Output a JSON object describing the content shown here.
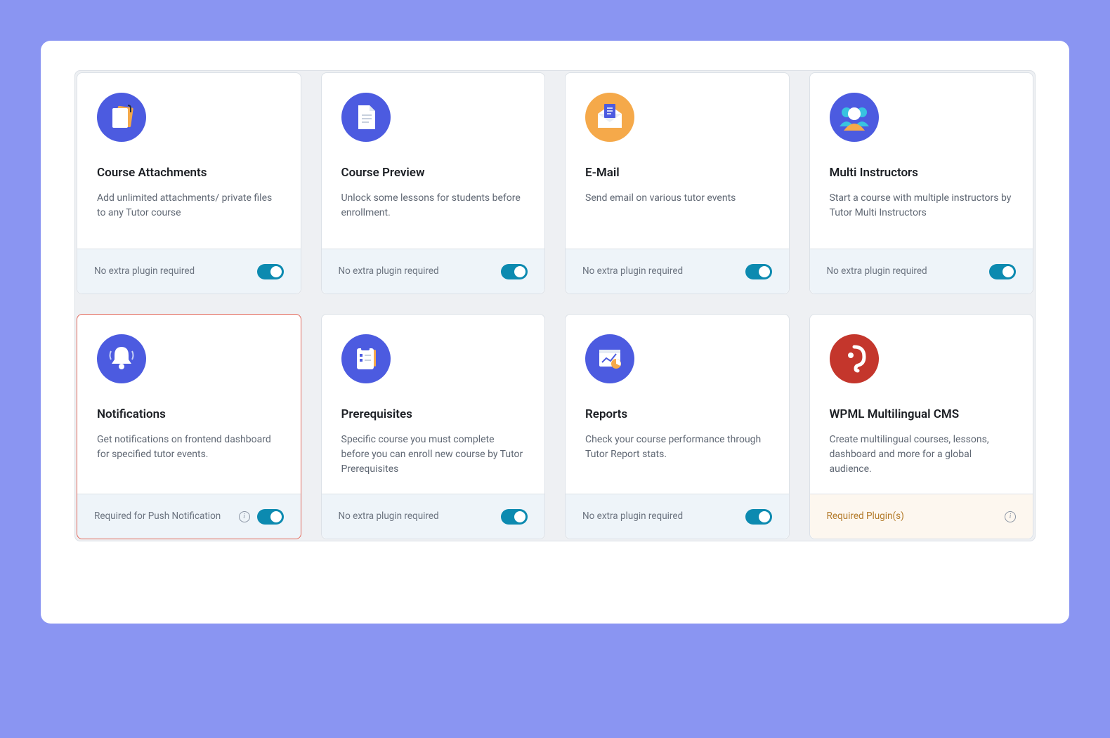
{
  "colors": {
    "blue": "#4c5be0",
    "orange": "#f5a94a",
    "red": "#c4362c"
  },
  "addons": [
    {
      "id": "course-attachments",
      "icon": "attachment",
      "title": "Course Attachments",
      "desc": "Add unlimited attachments/ private files to any Tutor course",
      "footer": "No extra plugin required",
      "toggle": true
    },
    {
      "id": "course-preview",
      "icon": "document",
      "title": "Course Preview",
      "desc": "Unlock some lessons for students before enrollment.",
      "footer": "No extra plugin required",
      "toggle": true
    },
    {
      "id": "email",
      "icon": "envelope",
      "title": "E-Mail",
      "desc": "Send email on various tutor events",
      "footer": "No extra plugin required",
      "toggle": true
    },
    {
      "id": "multi-instructors",
      "icon": "people",
      "title": "Multi Instructors",
      "desc": "Start a course with multiple instructors by Tutor Multi Instructors",
      "footer": "No extra plugin required",
      "toggle": true
    },
    {
      "id": "notifications",
      "icon": "bell",
      "title": "Notifications",
      "desc": "Get notifications on frontend dashboard for specified tutor events.",
      "footer": "Required for Push Notification",
      "info": true,
      "toggle": true,
      "highlight": true
    },
    {
      "id": "prerequisites",
      "icon": "checklist",
      "title": "Prerequisites",
      "desc": "Specific course you must complete before you can enroll new course by Tutor Prerequisites",
      "footer": "No extra plugin required",
      "toggle": true
    },
    {
      "id": "reports",
      "icon": "chart",
      "title": "Reports",
      "desc": "Check your course performance through Tutor Report stats.",
      "footer": "No extra plugin required",
      "toggle": true
    },
    {
      "id": "wpml",
      "icon": "wpml",
      "title": "WPML Multilingual CMS",
      "desc": "Create multilingual courses, lessons, dashboard and more for a global audience.",
      "footer": "Required Plugin(s)",
      "info": true,
      "toggle": false,
      "warn": true
    }
  ]
}
